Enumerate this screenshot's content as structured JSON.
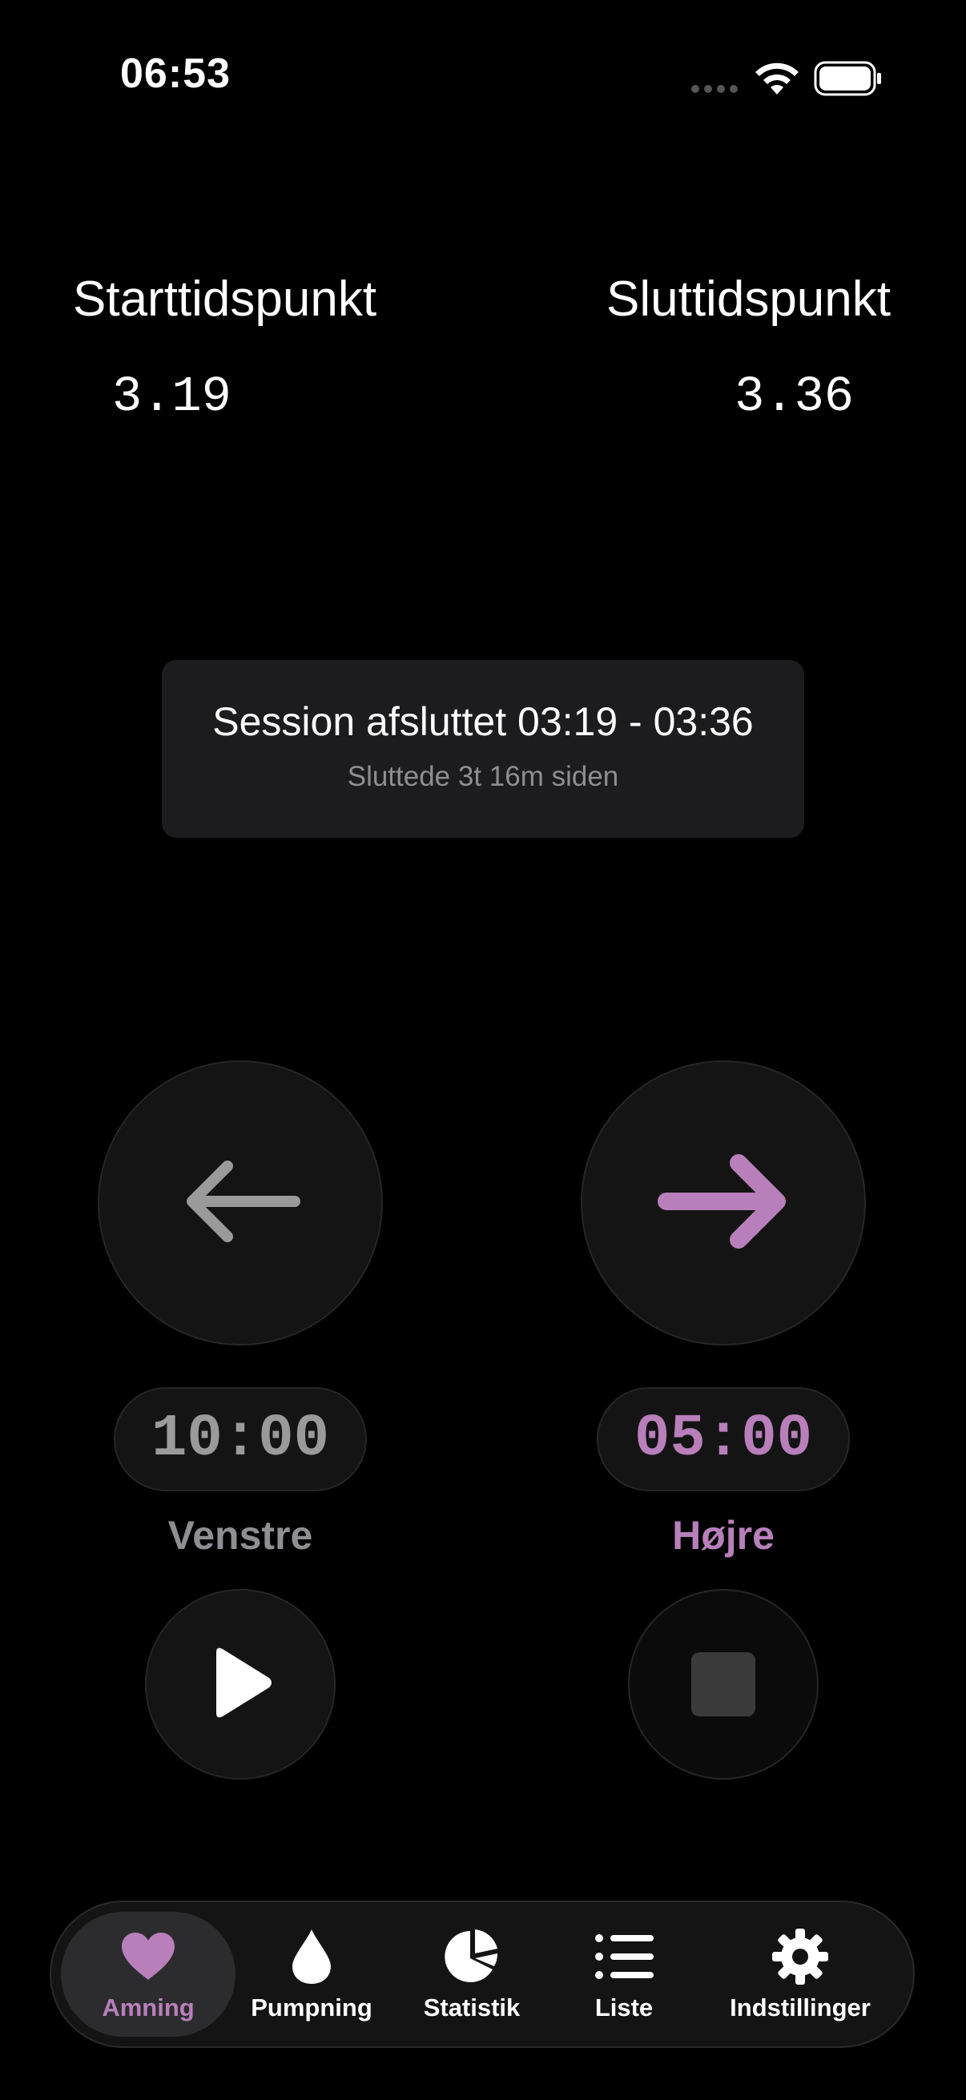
{
  "status_bar": {
    "time": "06:53"
  },
  "session_times": {
    "start_label": "Starttidspunkt",
    "start_value": "3.19",
    "end_label": "Sluttidspunkt",
    "end_value": "3.36"
  },
  "session_card": {
    "title": "Session afsluttet 03:19 - 03:36",
    "subtitle": "Sluttede 3t 16m siden"
  },
  "left_side": {
    "icon": "arrow-left-icon",
    "timer": "10:00",
    "label": "Venstre",
    "control": "play-icon"
  },
  "right_side": {
    "icon": "arrow-right-icon",
    "timer": "05:00",
    "label": "Højre",
    "control": "stop-icon"
  },
  "tab_bar": {
    "items": [
      {
        "label": "Amning",
        "icon": "heart-icon",
        "active": true
      },
      {
        "label": "Pumpning",
        "icon": "drop-icon",
        "active": false
      },
      {
        "label": "Statistik",
        "icon": "pie-chart-icon",
        "active": false
      },
      {
        "label": "Liste",
        "icon": "list-icon",
        "active": false
      },
      {
        "label": "Indstillinger",
        "icon": "gear-icon",
        "active": false
      }
    ]
  },
  "colors": {
    "accent": "#b87fbb",
    "inactive": "#9a9a9a",
    "background": "#000000",
    "card": "#1c1c1e"
  }
}
